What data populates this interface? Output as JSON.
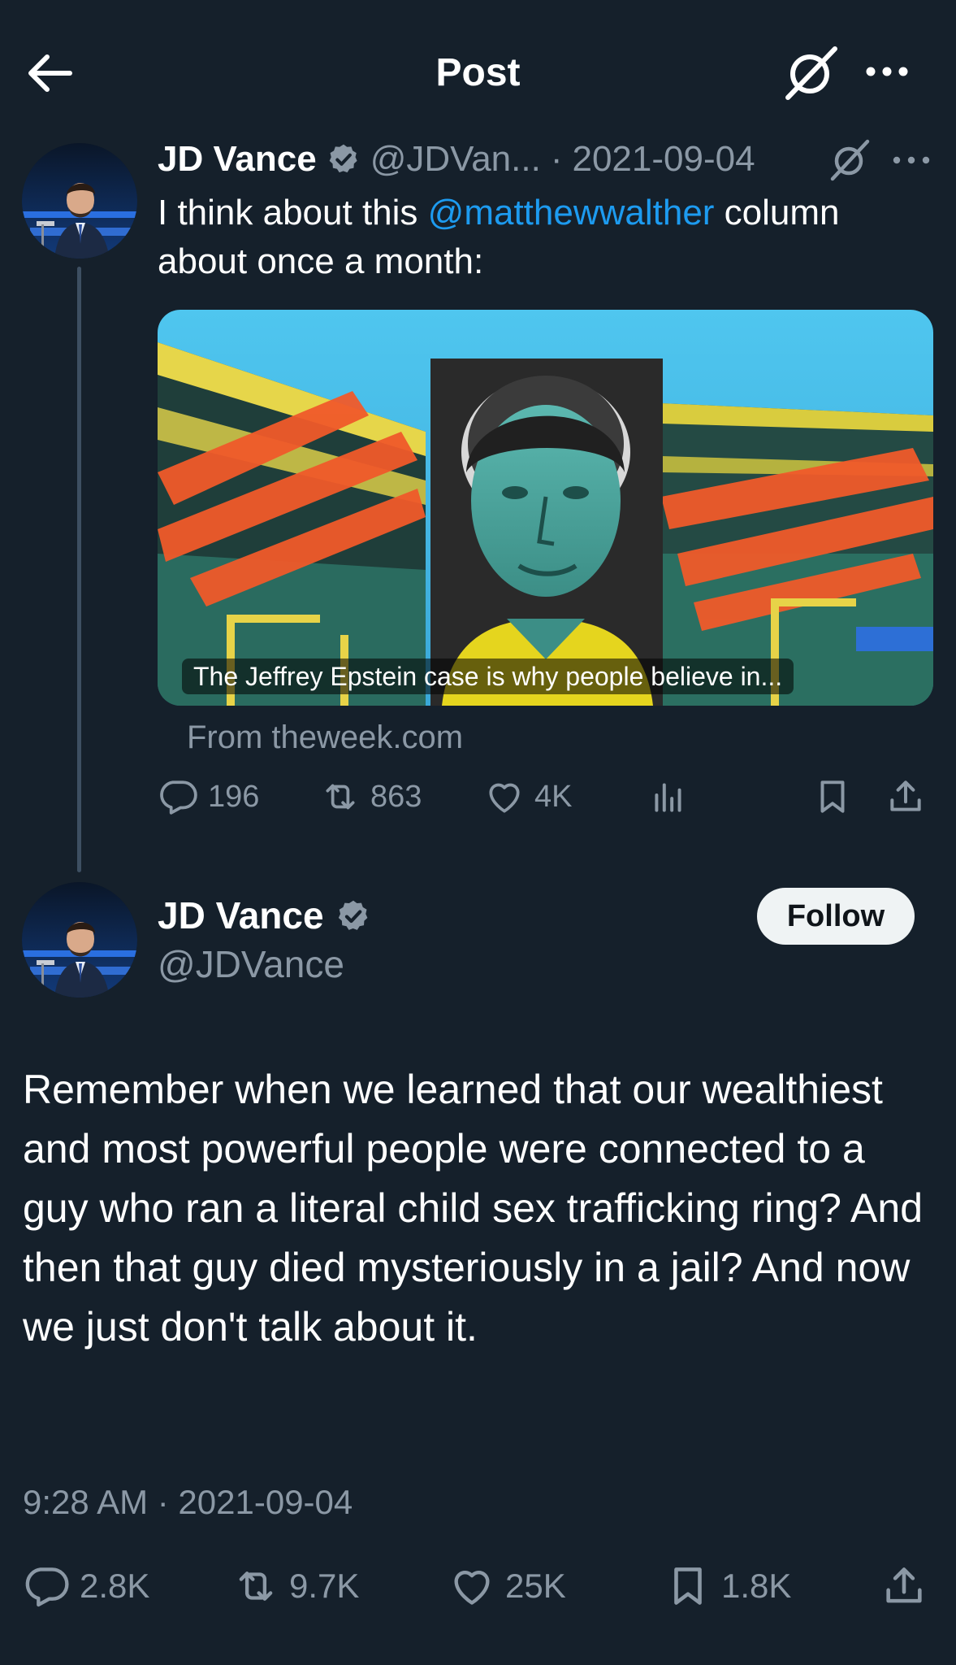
{
  "header": {
    "title": "Post"
  },
  "quoted": {
    "name": "JD Vance",
    "handle": "@JDVan...",
    "separator": "·",
    "date": "2021-09-04",
    "text_before": "I think about this ",
    "mention": "@matthewwalther",
    "text_after": " column about once a month:",
    "card": {
      "caption": "The Jeffrey Epstein case is why people believe in...",
      "source": "From theweek.com"
    },
    "actions": {
      "replies": "196",
      "reposts": "863",
      "likes": "4K"
    }
  },
  "main": {
    "name": "JD Vance",
    "handle": "@JDVance",
    "follow_label": "Follow",
    "text": "Remember when we learned that our wealthiest and most powerful people were connected to a guy who ran a literal child sex trafficking ring? And then that guy died mysteriously in a jail? And now we just don't talk about it.",
    "timestamp": "9:28 AM · 2021-09-04",
    "actions": {
      "replies": "2.8K",
      "reposts": "9.7K",
      "likes": "25K",
      "bookmarks": "1.8K"
    }
  },
  "colors": {
    "background": "#15202b",
    "accent": "#1d9bf0",
    "muted": "#8b98a5",
    "verified": "#8b98a5"
  },
  "icons": [
    "back-arrow-icon",
    "grok-icon",
    "more-icon",
    "verified-badge-icon",
    "reply-icon",
    "repost-icon",
    "like-icon",
    "views-icon",
    "bookmark-icon",
    "share-icon"
  ]
}
